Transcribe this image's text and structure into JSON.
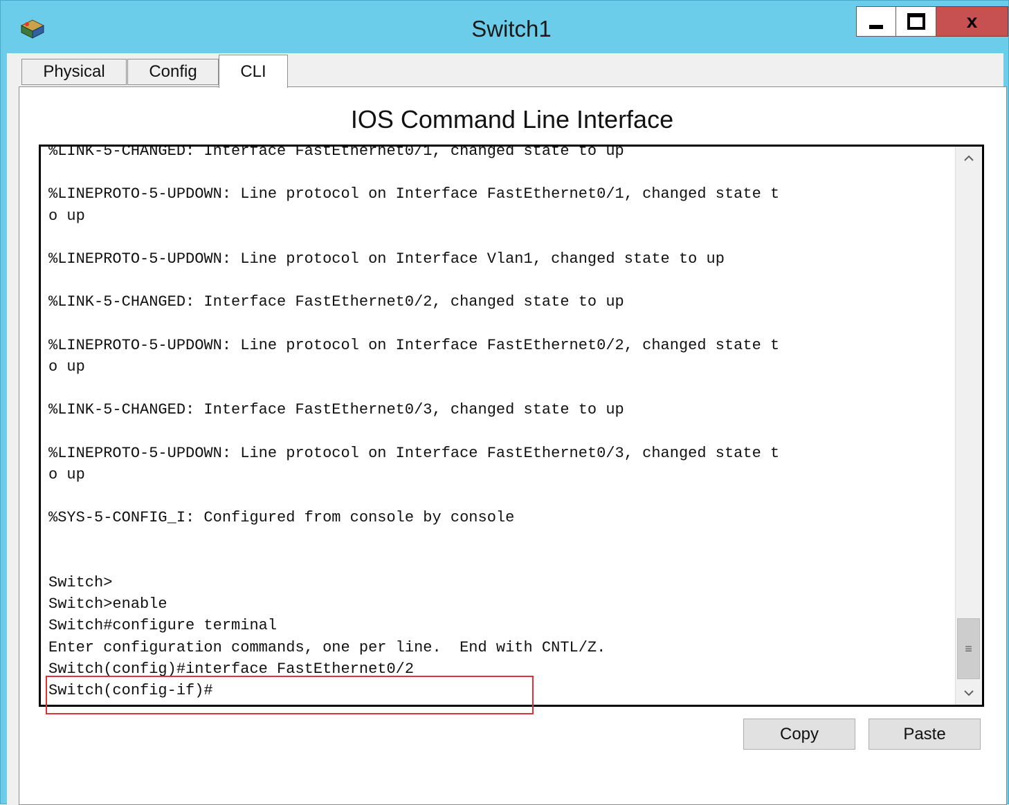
{
  "window": {
    "title": "Switch1",
    "app_icon": "packet-tracer-switch-icon",
    "controls": {
      "minimize": "minimize-icon",
      "maximize": "maximize-icon",
      "close_label": "x"
    }
  },
  "tabs": [
    {
      "label": "Physical",
      "active": false
    },
    {
      "label": "Config",
      "active": false
    },
    {
      "label": "CLI",
      "active": true
    }
  ],
  "panel": {
    "heading": "IOS Command Line Interface"
  },
  "console": {
    "text": "%LINK-5-CHANGED: Interface FastEthernet0/1, changed state to up\n\n%LINEPROTO-5-UPDOWN: Line protocol on Interface FastEthernet0/1, changed state t\no up\n\n%LINEPROTO-5-UPDOWN: Line protocol on Interface Vlan1, changed state to up\n\n%LINK-5-CHANGED: Interface FastEthernet0/2, changed state to up\n\n%LINEPROTO-5-UPDOWN: Line protocol on Interface FastEthernet0/2, changed state t\no up\n\n%LINK-5-CHANGED: Interface FastEthernet0/3, changed state to up\n\n%LINEPROTO-5-UPDOWN: Line protocol on Interface FastEthernet0/3, changed state t\no up\n\n%SYS-5-CONFIG_I: Configured from console by console\n\n\nSwitch>\nSwitch>enable\nSwitch#configure terminal\nEnter configuration commands, one per line.  End with CNTL/Z.\nSwitch(config)#interface FastEthernet0/2\nSwitch(config-if)#",
    "highlight_color": "#e0303a"
  },
  "scrollbar": {
    "up_icon": "chevron-up-icon",
    "down_icon": "chevron-down-icon",
    "thumb_grip": "≡"
  },
  "buttons": {
    "copy": "Copy",
    "paste": "Paste"
  },
  "colors": {
    "titlebar": "#6ccdea",
    "close_button": "#c75050"
  }
}
